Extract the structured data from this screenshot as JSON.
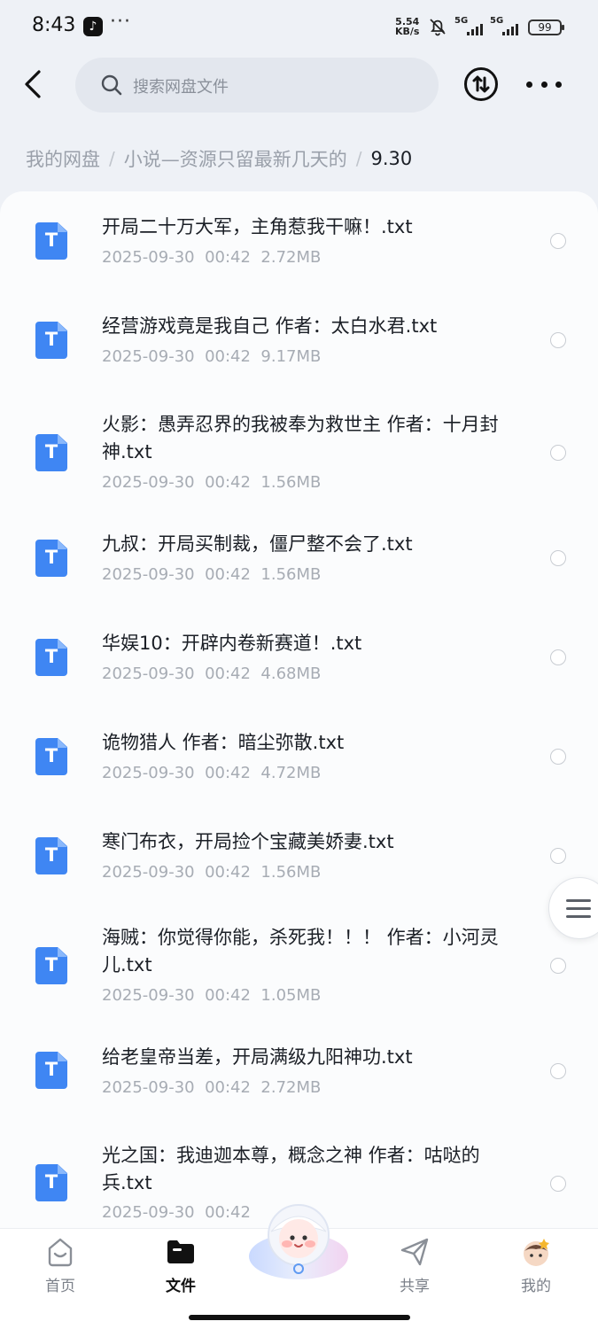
{
  "status_bar": {
    "time": "8:43",
    "app_icon": "tiktok-icon",
    "overflow": "···",
    "net_speed_value": "5.54",
    "net_speed_unit": "KB/s",
    "network_1": "5G",
    "network_2": "5G",
    "battery": "99"
  },
  "header": {
    "back_icon": "chevron-left-icon",
    "search_placeholder": "搜索网盘文件",
    "transfer_icon": "transfer-icon",
    "more_icon": "more-icon"
  },
  "breadcrumb": {
    "items": [
      "我的网盘",
      "小说—资源只留最新几天的"
    ],
    "current": "9.30",
    "separator": "/"
  },
  "files": [
    {
      "name": "开局二十万大军，主角惹我干嘛！.txt",
      "date": "2025-09-30",
      "time": "00:42",
      "size": "2.72MB",
      "icon_letter": "T"
    },
    {
      "name": "经营游戏竟是我自己 作者：太白水君.txt",
      "date": "2025-09-30",
      "time": "00:42",
      "size": "9.17MB",
      "icon_letter": "T"
    },
    {
      "name": "火影：愚弄忍界的我被奉为救世主 作者：十月封神.txt",
      "date": "2025-09-30",
      "time": "00:42",
      "size": "1.56MB",
      "icon_letter": "T"
    },
    {
      "name": "九叔：开局买制裁，僵尸整不会了.txt",
      "date": "2025-09-30",
      "time": "00:42",
      "size": "1.56MB",
      "icon_letter": "T"
    },
    {
      "name": "华娱10：开辟内卷新赛道！.txt",
      "date": "2025-09-30",
      "time": "00:42",
      "size": "4.68MB",
      "icon_letter": "T"
    },
    {
      "name": "诡物猎人 作者：暗尘弥散.txt",
      "date": "2025-09-30",
      "time": "00:42",
      "size": "4.72MB",
      "icon_letter": "T"
    },
    {
      "name": "寒门布衣，开局捡个宝藏美娇妻.txt",
      "date": "2025-09-30",
      "time": "00:42",
      "size": "1.56MB",
      "icon_letter": "T"
    },
    {
      "name": "海贼：你觉得你能，杀死我！！！ 作者：小河灵儿.txt",
      "date": "2025-09-30",
      "time": "00:42",
      "size": "1.05MB",
      "icon_letter": "T"
    },
    {
      "name": "给老皇帝当差，开局满级九阳神功.txt",
      "date": "2025-09-30",
      "time": "00:42",
      "size": "2.72MB",
      "icon_letter": "T"
    },
    {
      "name": "光之国：我迪迦本尊，概念之神 作者：咕哒的兵.txt",
      "date": "2025-09-30",
      "time": "00:42",
      "size": "",
      "icon_letter": "T"
    }
  ],
  "side_handle_icon": "menu-icon",
  "bottom_nav": {
    "items": [
      {
        "label": "首页",
        "icon": "home-icon",
        "active": false
      },
      {
        "label": "文件",
        "icon": "folder-icon",
        "active": true
      },
      {
        "label": "共享",
        "icon": "share-icon",
        "active": false
      },
      {
        "label": "我的",
        "icon": "avatar-icon",
        "active": false
      }
    ],
    "center_icon": "mascot-icon"
  },
  "colors": {
    "accent": "#3f86f3",
    "page_bg": "#eef1f6",
    "text_primary": "#1b1f26",
    "text_secondary": "#a7acb4"
  }
}
